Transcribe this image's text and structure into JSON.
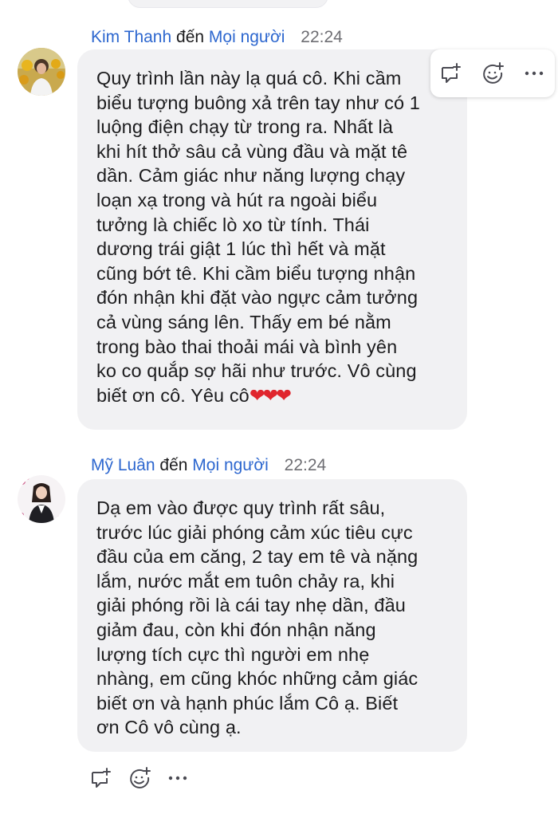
{
  "messages": [
    {
      "sender": "Kim Thanh",
      "connector": "đến",
      "recipient": "Mọi người",
      "time": "22:24",
      "text": "Quy trình lần này lạ quá cô. Khi cầm\nbiểu tượng buông xả trên tay như có 1\nluộng điện chạy từ trong ra. Nhất là\nkhi hít thở sâu cả vùng đầu và mặt tê\ndần. Cảm giác như năng lượng chạy\nloạn xạ trong và hút ra ngoài biểu\ntưởng là chiếc lò xo từ tính. Thái\ndương trái giật 1 lúc thì hết và mặt\ncũng bớt tê. Khi cầm biểu tượng nhận\nđón nhận khi đặt vào ngực cảm tưởng\ncả vùng sáng lên. Thấy em bé nằm\ntrong bào thai thoải mái và bình yên\nko co quắp sợ hãi như trước. Vô cùng\nbiết ơn cô. Yêu cô",
      "hearts": "❤❤❤"
    },
    {
      "sender": "Mỹ Luân",
      "connector": "đến",
      "recipient": "Mọi người",
      "time": "22:24",
      "text": "Dạ em vào được quy trình rất sâu,\ntrước lúc giải phóng cảm xúc tiêu cực\nđầu của em căng, 2 tay em tê và nặng\nlắm, nước mắt em tuôn chảy ra, khi\ngiải phóng rồi là cái tay nhẹ dần, đầu\ngiảm đau, còn khi đón nhận năng\nlượng tích cực thì người em nhẹ\nnhàng, em cũng khóc những cảm giác\nbiết ơn và hạnh phúc lắm Cô ạ. Biết\nơn Cô vô cùng ạ."
    }
  ],
  "icons": {
    "reply": "reply-in-thread-icon",
    "react": "add-reaction-icon",
    "more": "more-options-icon"
  },
  "colors": {
    "link": "#2d67cf",
    "bubble": "#f1f1f3",
    "heart": "#e0262e",
    "icon": "#4a4a52"
  }
}
